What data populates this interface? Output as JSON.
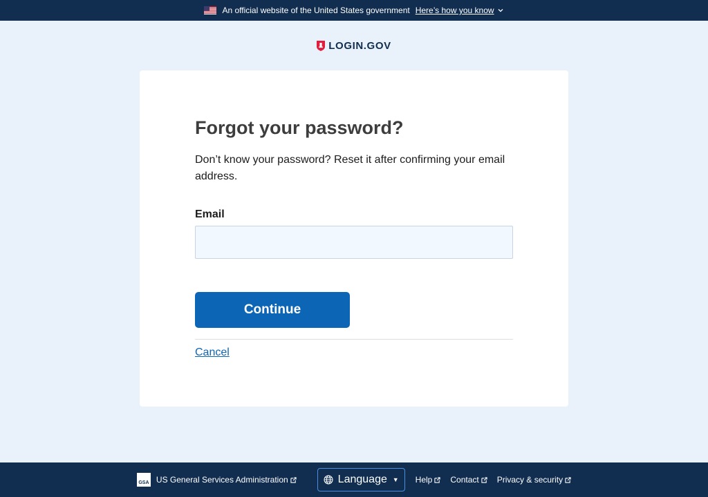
{
  "banner": {
    "text": "An official website of the United States government",
    "link_label": "Here’s how you know"
  },
  "brand": {
    "name": "LOGIN.GOV"
  },
  "form": {
    "heading": "Forgot your password?",
    "intro": "Don’t know your password? Reset it after confirming your email address.",
    "email_label": "Email",
    "email_value": "",
    "continue_label": "Continue",
    "cancel_label": "Cancel"
  },
  "footer": {
    "gsa_label": "US General Services Administration",
    "gsa_logo": "GSA",
    "language_label": "Language",
    "links": [
      "Help",
      "Contact",
      "Privacy & security"
    ]
  },
  "icons": {
    "flag": "us-flag-icon",
    "shield": "login-shield-icon",
    "external": "external-link-icon",
    "globe": "globe-icon"
  },
  "colors": {
    "navy": "#112e51",
    "primary": "#0d65b5",
    "background": "#e9f1fa",
    "shield_red": "#e21c3d"
  }
}
